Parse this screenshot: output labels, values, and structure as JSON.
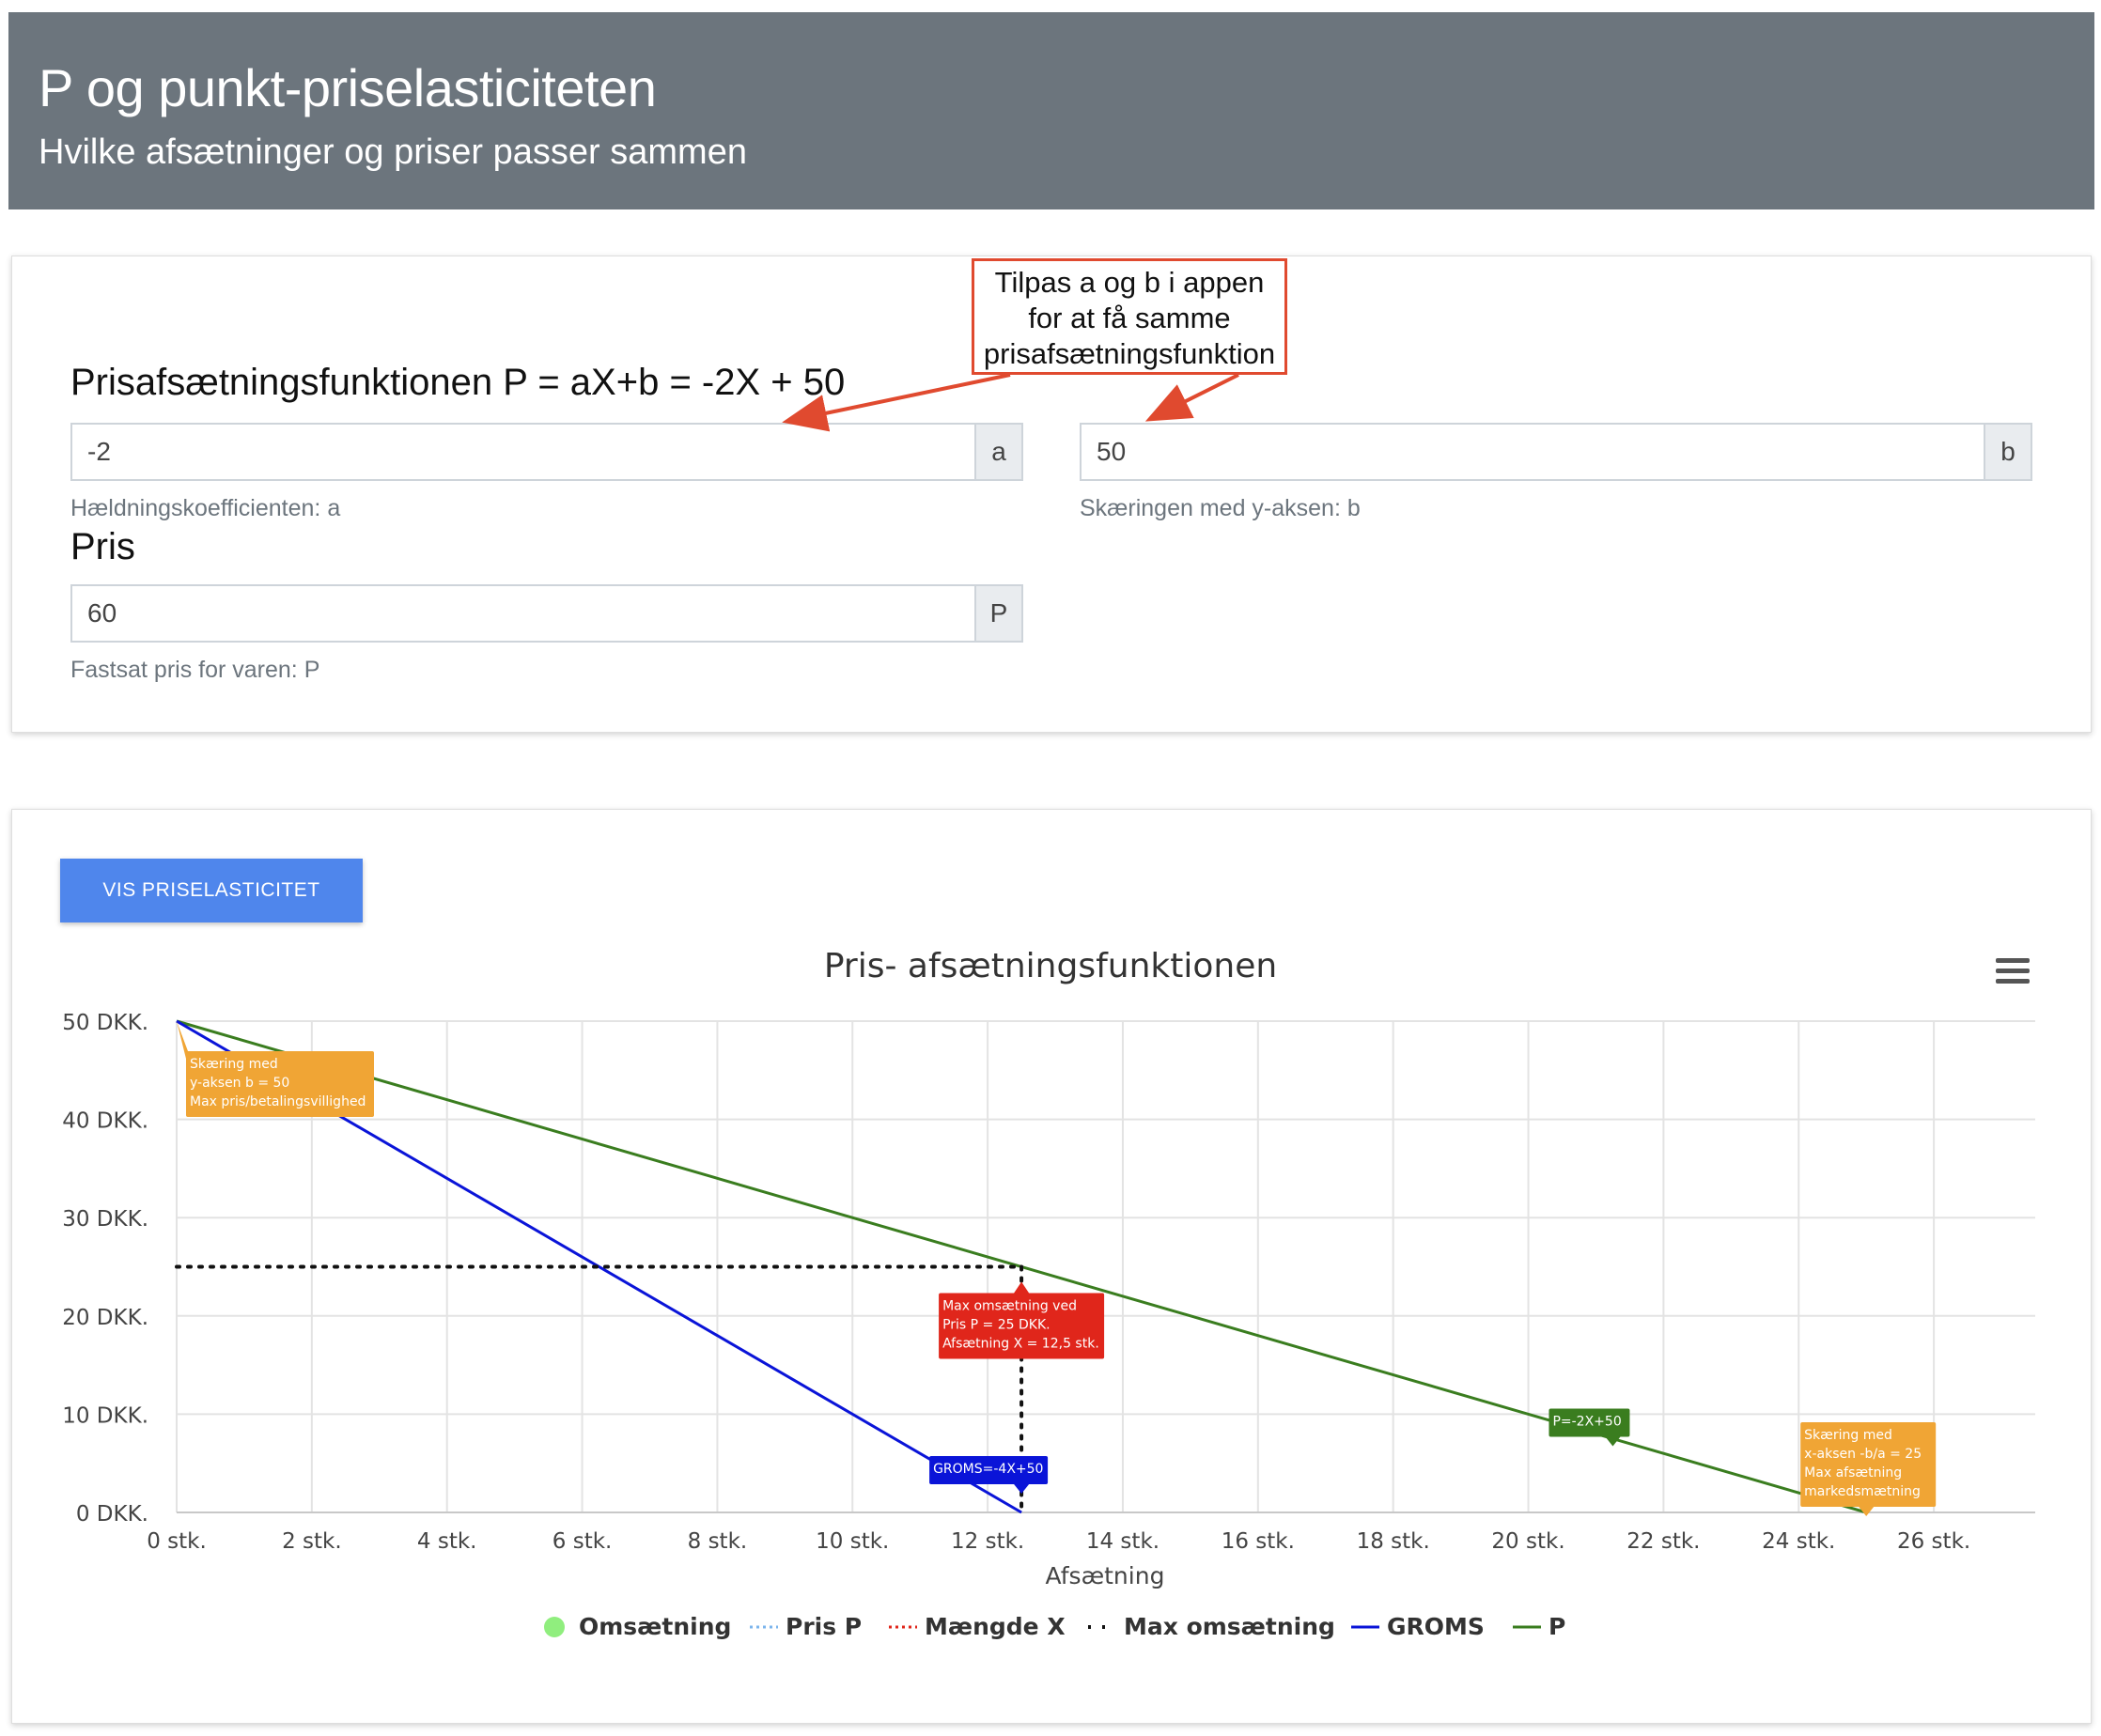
{
  "header": {
    "title": "P og punkt-priselasticiteten",
    "subtitle": "Hvilke afsætninger og priser passer sammen"
  },
  "form": {
    "function_title": "Prisafsætningsfunktionen P = aX+b = -2X + 50",
    "a": {
      "value": "-2",
      "addon": "a",
      "help": "Hældningskoefficienten: a"
    },
    "b": {
      "value": "50",
      "addon": "b",
      "help": "Skæringen med y-aksen: b"
    },
    "price_title": "Pris",
    "p": {
      "value": "60",
      "addon": "P",
      "help": "Fastsat pris for varen: P"
    }
  },
  "callout": {
    "line1": "Tilpas a og b i appen",
    "line2": "for at få samme",
    "line3": "prisafsætningsfunktion",
    "color": "#e04a2f"
  },
  "button": {
    "label": "VIS PRISELASTICITET"
  },
  "chart_data": {
    "type": "line",
    "title": "Pris- afsætningsfunktionen",
    "xlabel": "Afsætning",
    "ylabel": "",
    "xlim": [
      0,
      27.5
    ],
    "ylim": [
      0,
      50
    ],
    "xticks": [
      0,
      2,
      4,
      6,
      8,
      10,
      12,
      14,
      16,
      18,
      20,
      22,
      24,
      26
    ],
    "xtick_labels": [
      "0 stk.",
      "2 stk.",
      "4 stk.",
      "6 stk.",
      "8 stk.",
      "10 stk.",
      "12 stk.",
      "14 stk.",
      "16 stk.",
      "18 stk.",
      "20 stk.",
      "22 stk.",
      "24 stk.",
      "26 stk."
    ],
    "yticks": [
      0,
      10,
      20,
      30,
      40,
      50
    ],
    "ytick_labels": [
      "0 DKK.",
      "10 DKK.",
      "20 DKK.",
      "30 DKK.",
      "40 DKK.",
      "50 DKK."
    ],
    "grid": true,
    "legend_position": "bottom",
    "series": [
      {
        "name": "P",
        "color": "#3a7d1f",
        "style": "solid",
        "x": [
          0,
          25
        ],
        "y": [
          50,
          0
        ]
      },
      {
        "name": "GROMS",
        "color": "#0a14d8",
        "style": "solid",
        "x": [
          0,
          12.5
        ],
        "y": [
          50,
          0
        ]
      },
      {
        "name": "Max omsætning",
        "color": "#111111",
        "style": "dotted",
        "x": [
          0,
          12.5
        ],
        "y": [
          25,
          25
        ]
      },
      {
        "name": "Max omsætning",
        "color": "#111111",
        "style": "dotted",
        "x": [
          12.5,
          12.5
        ],
        "y": [
          25,
          0
        ]
      }
    ],
    "legend": [
      {
        "name": "Omsætning",
        "color": "#90ee7e",
        "symbol": "circle"
      },
      {
        "name": "Pris P",
        "color": "#7cb5ec",
        "symbol": "dotted"
      },
      {
        "name": "Mængde X",
        "color": "#e0261b",
        "symbol": "dotted"
      },
      {
        "name": "Max omsætning",
        "color": "#111111",
        "symbol": "dotted-sparse"
      },
      {
        "name": "GROMS",
        "color": "#0a14d8",
        "symbol": "line"
      },
      {
        "name": "P",
        "color": "#3a7d1f",
        "symbol": "line"
      }
    ],
    "annotations": [
      {
        "at": [
          0,
          50
        ],
        "color": "#f0a535",
        "lines": [
          "Skæring med",
          "y-aksen b = 50",
          "Max pris/betalingsvillighed"
        ]
      },
      {
        "at": [
          12.5,
          25
        ],
        "color": "#e0261b",
        "lines": [
          "Max omsætning ved",
          "Pris P = 25 DKK.",
          "Afsætning X = 12,5 stk."
        ]
      },
      {
        "at": [
          12.5,
          0
        ],
        "color": "#0a14d8",
        "lines": [
          "GROMS=-4X+50"
        ]
      },
      {
        "at": [
          21.25,
          7.5
        ],
        "color": "#3a7d1f",
        "lines": [
          "P=-2X+50"
        ]
      },
      {
        "at": [
          25,
          0
        ],
        "color": "#f0a535",
        "lines": [
          "Skæring med",
          "x-aksen -b/a = 25",
          "Max afsætning",
          "markedsmætning"
        ]
      }
    ]
  }
}
